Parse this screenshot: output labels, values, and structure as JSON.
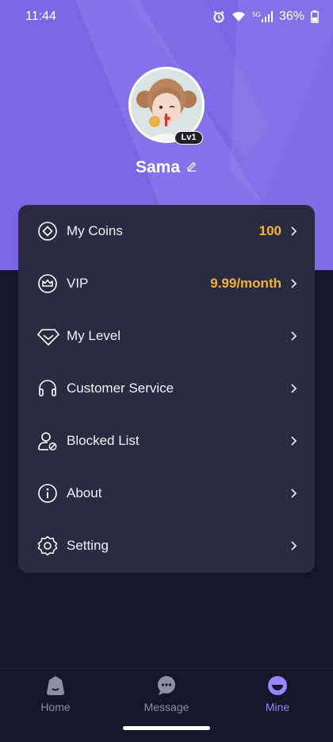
{
  "status_bar": {
    "time": "11:44",
    "network": "5G",
    "battery": "36%",
    "icons": [
      "alarm-icon",
      "wifi-icon",
      "signal-icon",
      "battery-icon"
    ]
  },
  "profile": {
    "level": "Lv1",
    "username": "Sama"
  },
  "menu": [
    {
      "label": "My Coins",
      "value": "100",
      "icon": "coin-icon"
    },
    {
      "label": "VIP",
      "value": "9.99/month",
      "icon": "crown-icon"
    },
    {
      "label": "My Level",
      "value": "",
      "icon": "diamond-icon"
    },
    {
      "label": "Customer Service",
      "value": "",
      "icon": "headset-icon"
    },
    {
      "label": "Blocked List",
      "value": "",
      "icon": "blocked-user-icon"
    },
    {
      "label": "About",
      "value": "",
      "icon": "info-icon"
    },
    {
      "label": "Setting",
      "value": "",
      "icon": "settings-icon"
    }
  ],
  "tabs": [
    {
      "label": "Home",
      "icon": "home-icon",
      "active": false
    },
    {
      "label": "Message",
      "icon": "message-icon",
      "active": false
    },
    {
      "label": "Mine",
      "icon": "mine-icon",
      "active": true
    }
  ],
  "colors": {
    "accent": "#7b67e6",
    "value_highlight": "#f3b23a",
    "card": "#2a2b41",
    "background": "#15162a",
    "active_tab": "#9b85ff"
  }
}
